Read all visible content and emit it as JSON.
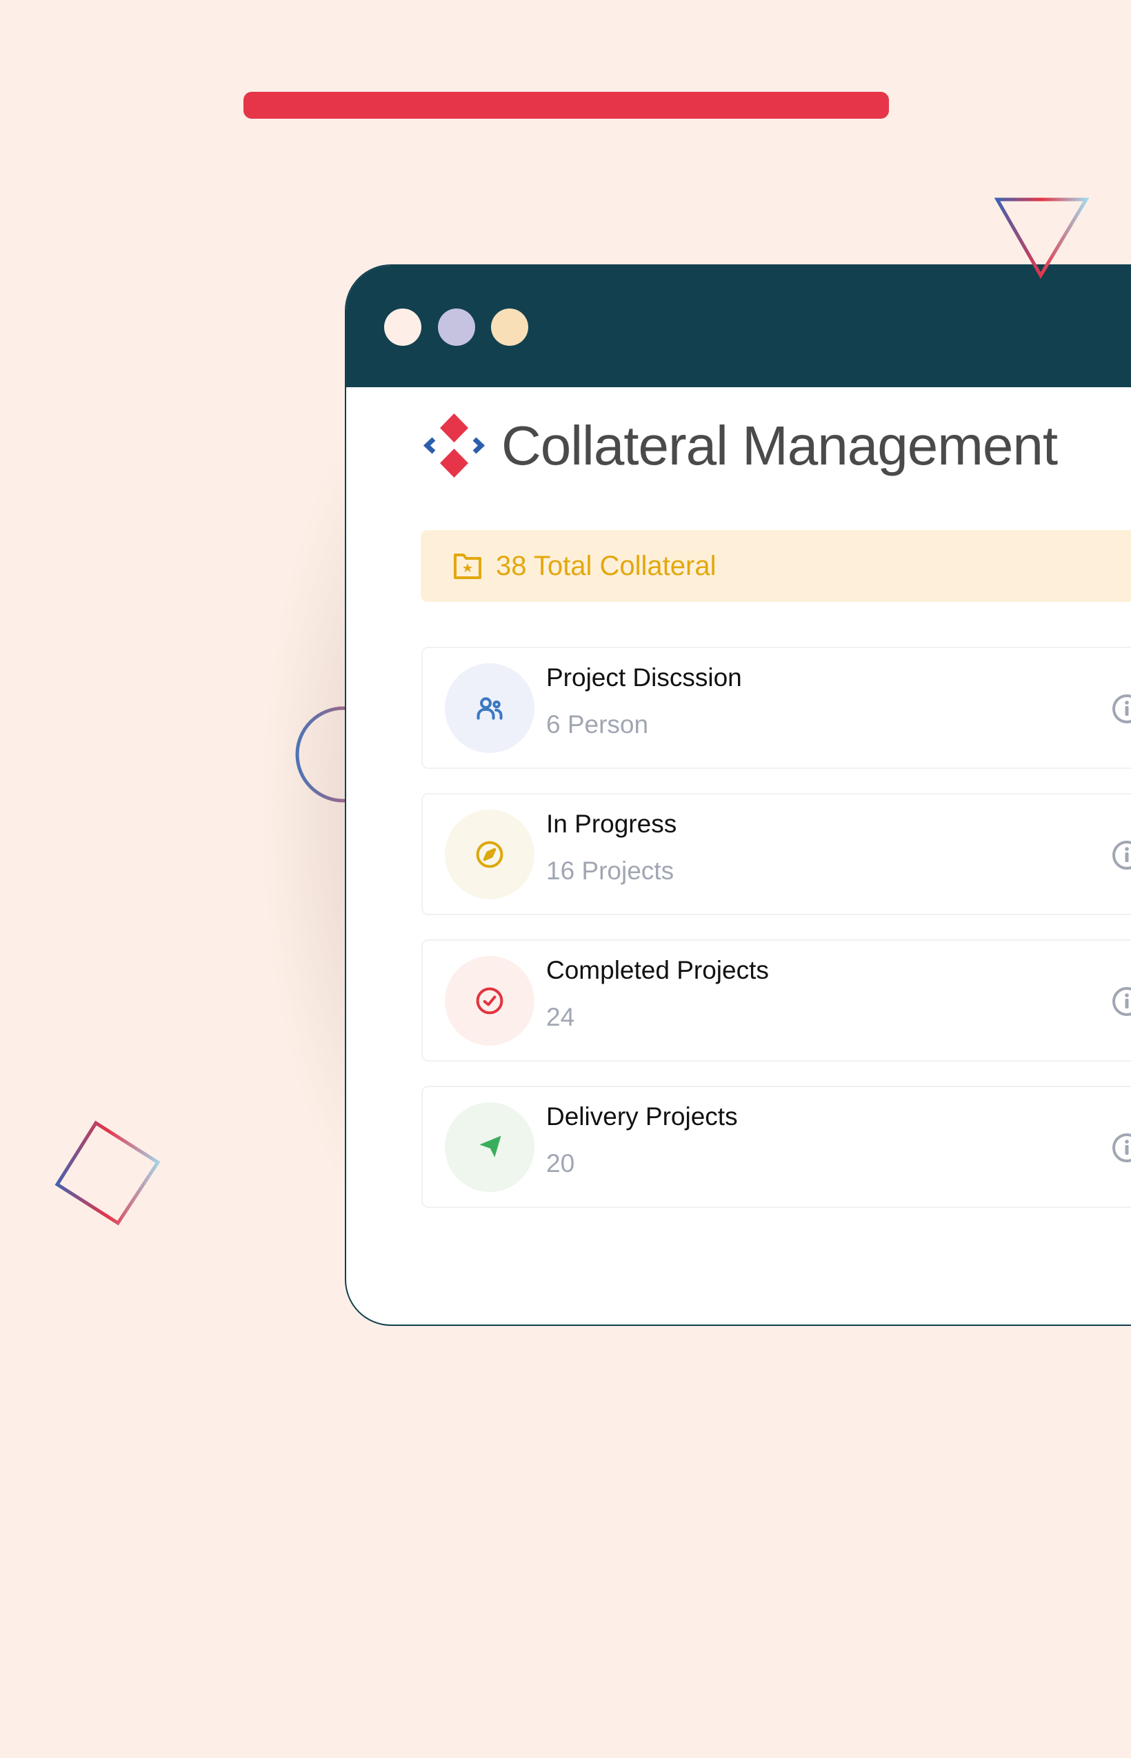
{
  "app": {
    "title": "Collateral Management"
  },
  "window_controls": [
    {
      "name": "close",
      "color": "#FDEFE7"
    },
    {
      "name": "minimize",
      "color": "#C6C3E1"
    },
    {
      "name": "maximize",
      "color": "#F8DFB7"
    }
  ],
  "summary": {
    "icon": "folder-star-icon",
    "text": "38 Total Collateral",
    "color": "#E3A70E",
    "background": "#FEF0D8"
  },
  "cards": [
    {
      "title": "Project Discssion",
      "subtitle": "6 Person",
      "icon": "users-icon",
      "icon_color": "#3B78C0",
      "icon_bg": "#EEF1FA"
    },
    {
      "title": "In Progress",
      "subtitle": "16 Projects",
      "icon": "compass-icon",
      "icon_color": "#DDA80E",
      "icon_bg": "#FAF6EA"
    },
    {
      "title": "Completed Projects",
      "subtitle": "24",
      "icon": "check-circle-icon",
      "icon_color": "#E3343F",
      "icon_bg": "#FDF0EC"
    },
    {
      "title": "Delivery Projects",
      "subtitle": "20",
      "icon": "navigation-arrow-icon",
      "icon_color": "#3BAE5D",
      "icon_bg": "#EEF6EE"
    }
  ],
  "colors": {
    "background": "#FDEFE7",
    "accent_bar": "#E63549",
    "titlebar": "#12404F",
    "title_text": "#4A4A4A",
    "logo_red": "#E63549",
    "logo_blue": "#2B5FAE",
    "info_icon": "#A0A6B2"
  }
}
